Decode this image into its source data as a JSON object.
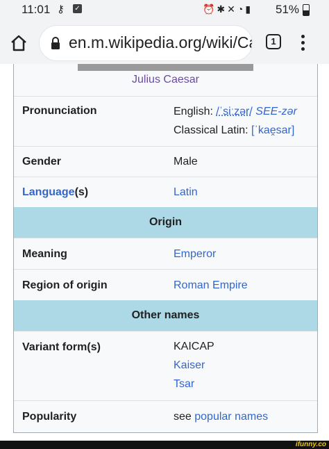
{
  "status_bar": {
    "time": "11:01",
    "battery": "51%"
  },
  "browser": {
    "url": "en.m.wikipedia.org/wiki/Cae",
    "tab_count": "1"
  },
  "infobox": {
    "caption": "Julius Caesar",
    "rows": {
      "pronunciation_label": "Pronunciation",
      "pronunciation_english_prefix": "English: ",
      "pronunciation_english_ipa": "/ˈsiːzər/",
      "pronunciation_english_respell": "SEE-zər",
      "pronunciation_latin_prefix": "Classical Latin: ",
      "pronunciation_latin_ipa": "[ˈkae̯sar]",
      "gender_label": "Gender",
      "gender_value": "Male",
      "language_label_link": "Language",
      "language_label_suffix": "(s)",
      "language_value": "Latin",
      "origin_header": "Origin",
      "meaning_label": "Meaning",
      "meaning_value": "Emperor",
      "region_label": "Region of origin",
      "region_value": "Roman Empire",
      "other_names_header": "Other names",
      "variant_label": "Variant form(s)",
      "variant_1": "KAICAP",
      "variant_2": "Kaiser",
      "variant_3": "Tsar",
      "popularity_label": "Popularity",
      "popularity_prefix": "see ",
      "popularity_link": "popular names"
    }
  },
  "watermark": "ifunny.co",
  "colors": {
    "link": "#3366cc",
    "visited": "#6b4ba1",
    "header_bg": "#add8e6"
  }
}
